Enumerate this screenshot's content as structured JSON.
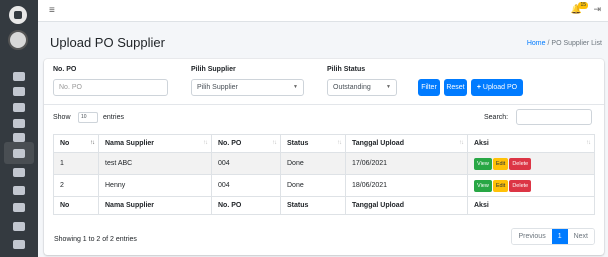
{
  "app": {
    "brand_icon": "brand-logo",
    "user_icon": "user-avatar",
    "colors": {
      "sidebar": "#343a40",
      "primary": "#007bff",
      "success": "#28a745",
      "warning": "#ffc107",
      "danger": "#dc3545"
    }
  },
  "topbar": {
    "menu_icon": "≡",
    "notification_count": "15",
    "bell_glyph": "🔔",
    "logout_glyph": "⇥"
  },
  "page": {
    "title": "Upload PO Supplier"
  },
  "breadcrumb": {
    "home": "Home",
    "separator": "/",
    "current": "PO Supplier List"
  },
  "filters": {
    "no_po": {
      "label": "No. PO",
      "placeholder": "No. PO"
    },
    "supplier": {
      "label": "Pilih Supplier",
      "value": "Pilih Supplier"
    },
    "status": {
      "label": "Pilih Status",
      "value": "Outstanding"
    }
  },
  "buttons": {
    "filter": "Filter",
    "reset": "Reset",
    "upload_icon": "+",
    "upload": "Upload PO"
  },
  "table_controls": {
    "show": "Show",
    "entries_value": "10",
    "entries": "entries",
    "search_label": "Search:"
  },
  "table": {
    "columns": [
      "No",
      "Nama Supplier",
      "No. PO",
      "Status",
      "Tanggal Upload",
      "Aksi"
    ],
    "rows": [
      {
        "no": "1",
        "supplier": "test ABC",
        "po": "004",
        "status": "Done",
        "date": "17/06/2021"
      },
      {
        "no": "2",
        "supplier": "Henny",
        "po": "004",
        "status": "Done",
        "date": "18/06/2021"
      }
    ],
    "actions": {
      "view": "View",
      "edit": "Edit",
      "delete": "Delete"
    }
  },
  "footer": {
    "info": "Showing 1 to 2 of 2 entries",
    "previous": "Previous",
    "page": "1",
    "next": "Next"
  }
}
